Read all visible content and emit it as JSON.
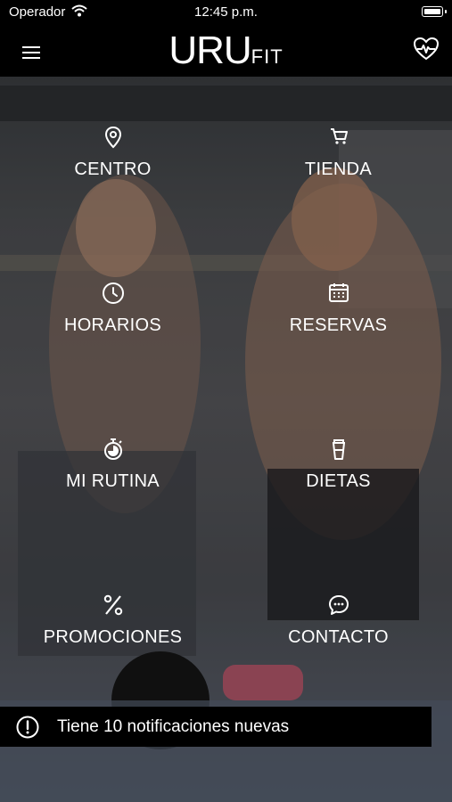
{
  "status_bar": {
    "carrier": "Operador",
    "time": "12:45 p.m."
  },
  "header": {
    "logo_main": "URU",
    "logo_sub": "FIT"
  },
  "menu": {
    "centro": "CENTRO",
    "tienda": "TIENDA",
    "horarios": "HORARIOS",
    "reservas": "RESERVAS",
    "mi_rutina": "MI RUTINA",
    "dietas": "DIETAS",
    "promociones": "PROMOCIONES",
    "contacto": "CONTACTO"
  },
  "notification": {
    "text": "Tiene 10 notificaciones nuevas"
  },
  "icons": {
    "menu": "hamburger-menu-icon",
    "heart": "heart-pulse-icon",
    "centro": "location-pin-icon",
    "tienda": "shopping-cart-icon",
    "horarios": "clock-icon",
    "reservas": "calendar-icon",
    "mi_rutina": "stopwatch-icon",
    "dietas": "cup-icon",
    "promociones": "percent-icon",
    "contacto": "chat-bubble-icon",
    "notification": "exclamation-circle-icon"
  }
}
